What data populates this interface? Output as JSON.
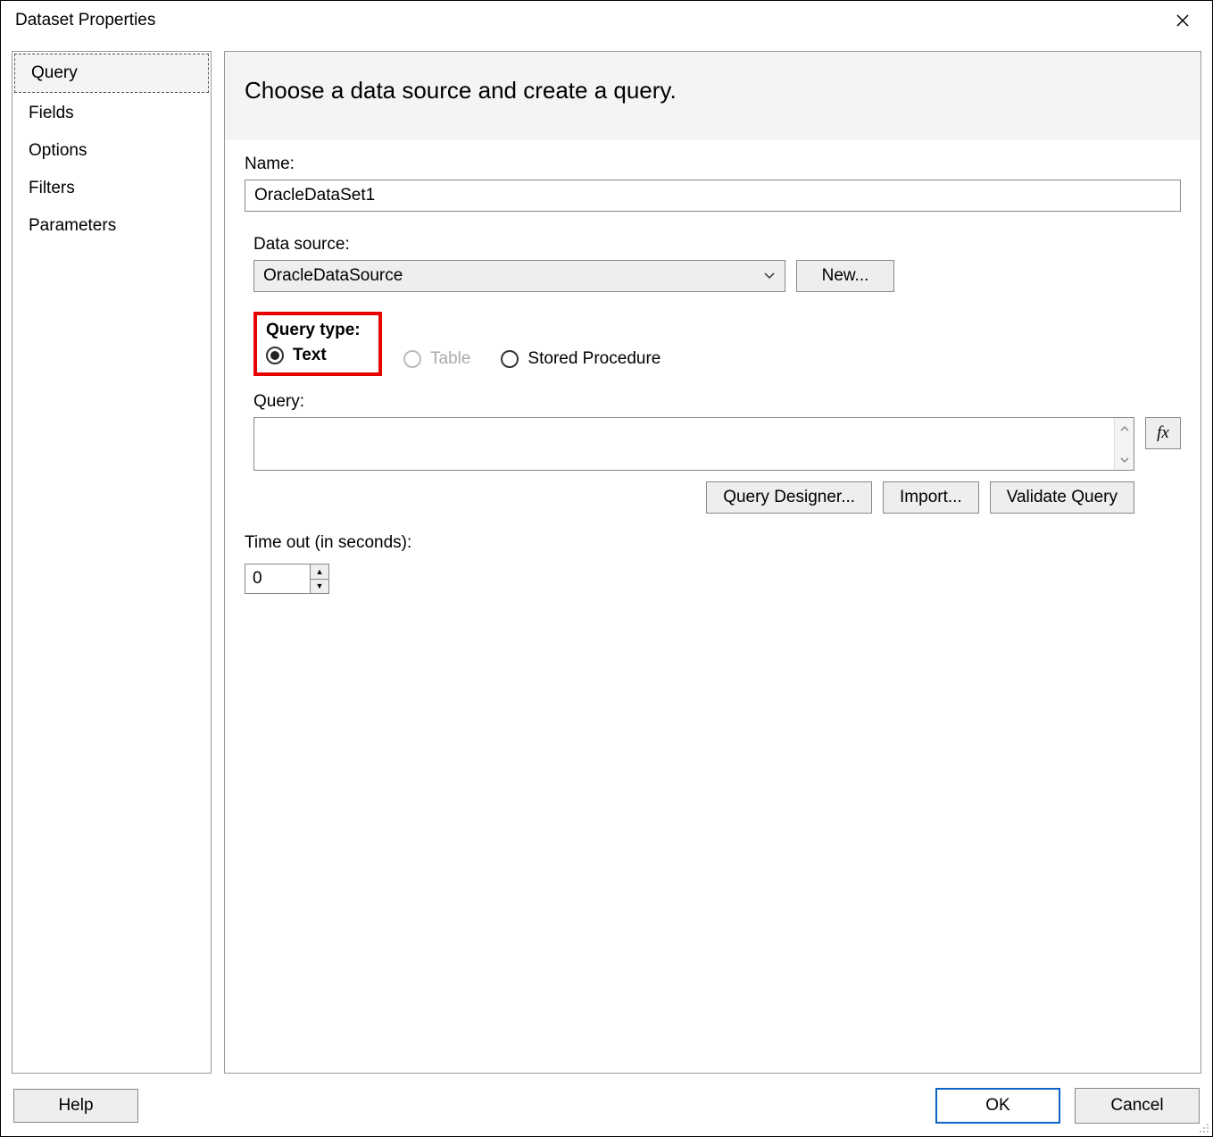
{
  "title": "Dataset Properties",
  "sidebar": {
    "items": [
      {
        "label": "Query",
        "selected": true
      },
      {
        "label": "Fields",
        "selected": false
      },
      {
        "label": "Options",
        "selected": false
      },
      {
        "label": "Filters",
        "selected": false
      },
      {
        "label": "Parameters",
        "selected": false
      }
    ]
  },
  "main": {
    "heading": "Choose a data source and create a query.",
    "name_label": "Name:",
    "name_value": "OracleDataSet1",
    "datasource_label": "Data source:",
    "datasource_value": "OracleDataSource",
    "new_button": "New...",
    "query_type_label": "Query type:",
    "query_type_options": {
      "text": "Text",
      "table": "Table",
      "stored_procedure": "Stored Procedure"
    },
    "query_label": "Query:",
    "query_value": "",
    "fx_label": "fx",
    "query_designer_button": "Query Designer...",
    "import_button": "Import...",
    "validate_button": "Validate Query",
    "timeout_label": "Time out (in seconds):",
    "timeout_value": "0"
  },
  "buttons": {
    "help": "Help",
    "ok": "OK",
    "cancel": "Cancel"
  }
}
